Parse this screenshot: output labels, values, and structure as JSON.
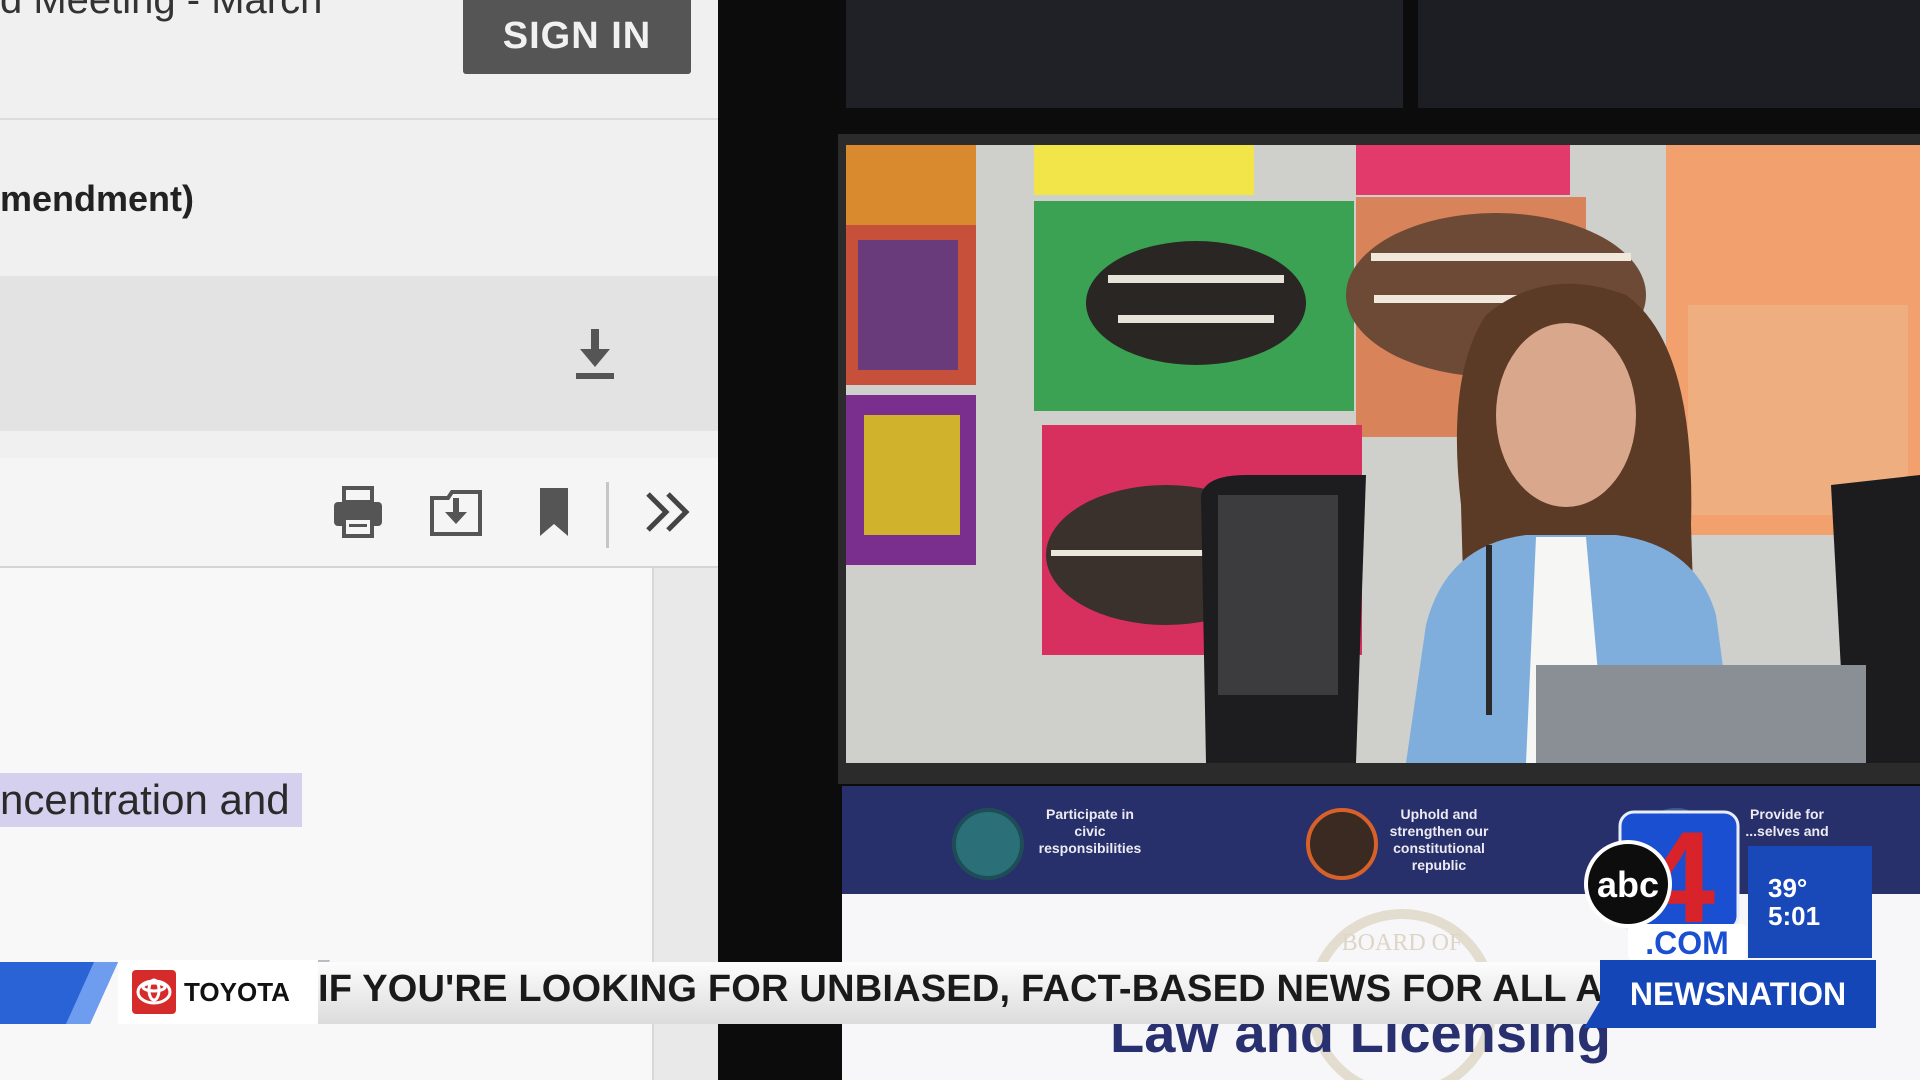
{
  "browser": {
    "title_fragment": "d Meeting - March",
    "sign_in_label": "SIGN IN",
    "item_title": "mendment)",
    "download_icon": "download-icon",
    "toolbar_icons": [
      "print-icon",
      "save-to-folder-icon",
      "bookmark-icon",
      "chevron-double-right-icon"
    ],
    "highlighted_text": "ncentration and"
  },
  "meeting": {
    "banner_goals": [
      {
        "text": "Participate in civic responsibilities",
        "icon": "civic-seal-icon"
      },
      {
        "text": "Uphold and strengthen our constitutional republic",
        "icon": "constitution-seal-icon"
      },
      {
        "text": "Provide for ...selves and",
        "icon": "provide-seal-icon"
      }
    ],
    "doc_seal_text": "BOARD OF",
    "doc_heading": "Law and Licensing"
  },
  "broadcast": {
    "sponsor": "TOYOTA",
    "ticker": "IF YOU'RE LOOKING FOR UNBIASED, FACT-BASED NEWS FOR ALL AM",
    "network": "NEWSNATION",
    "station_logo": {
      "prefix": "abc",
      "number": "4",
      "suffix": ".COM"
    },
    "temperature": "39°",
    "time": "5:01",
    "colors": {
      "station_blue": "#1948b8",
      "station_red": "#d8232a",
      "banner_navy": "#27306a"
    }
  }
}
